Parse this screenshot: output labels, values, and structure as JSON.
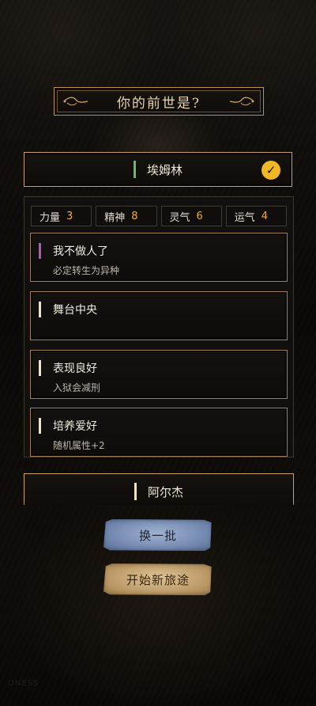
{
  "title": "你的前世是?",
  "selected": {
    "name": "埃姆林",
    "accent": "#5fbf6a",
    "checked": true
  },
  "stats": [
    {
      "label": "力量",
      "value": "3"
    },
    {
      "label": "精神",
      "value": "8"
    },
    {
      "label": "灵气",
      "value": "6"
    },
    {
      "label": "运气",
      "value": "4"
    }
  ],
  "talents": [
    {
      "name": "我不做人了",
      "desc": "必定转生为异种",
      "accent": "#b456b8"
    },
    {
      "name": "舞台中央",
      "desc": "",
      "accent": "#f2e4bf"
    },
    {
      "name": "表现良好",
      "desc": "入狱会减刑",
      "accent": "#f2e4bf"
    },
    {
      "name": "培养爱好",
      "desc": "随机属性+2",
      "accent": "#f2e4bf"
    }
  ],
  "next": {
    "name": "阿尔杰",
    "accent": "#f2e4bf"
  },
  "buttons": {
    "refresh": "换一批",
    "start": "开始新旅途"
  },
  "watermark": "ONESS"
}
